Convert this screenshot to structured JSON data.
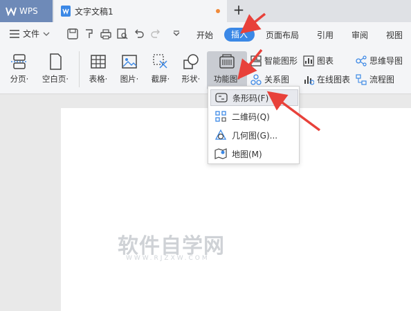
{
  "titlebar": {
    "app_tab": "WPS",
    "doc_tab": "文字文稿1"
  },
  "menubar": {
    "file_label": "文件",
    "tabs": [
      "开始",
      "插入",
      "页面布局",
      "引用",
      "审阅",
      "视图"
    ],
    "active_tab": "插入"
  },
  "ribbon": {
    "buttons": [
      {
        "label": "分页·",
        "icon": "page-break-icon"
      },
      {
        "label": "空白页·",
        "icon": "blank-page-icon"
      },
      {
        "label": "表格·",
        "icon": "table-icon"
      },
      {
        "label": "图片·",
        "icon": "picture-icon"
      },
      {
        "label": "截屏·",
        "icon": "screenshot-icon"
      },
      {
        "label": "形状·",
        "icon": "shape-icon"
      },
      {
        "label": "功能图·",
        "icon": "function-chart-icon"
      }
    ],
    "small_buttons": [
      {
        "label": "智能图形",
        "icon": "smart-art-icon"
      },
      {
        "label": "关系图",
        "icon": "relation-chart-icon"
      },
      {
        "label": "图表",
        "icon": "chart-icon"
      },
      {
        "label": "在线图表",
        "icon": "online-chart-icon"
      },
      {
        "label": "思维导图",
        "icon": "mind-map-icon"
      },
      {
        "label": "流程图",
        "icon": "flowchart-icon"
      }
    ]
  },
  "dropdown": {
    "items": [
      {
        "label": "条形码(F)",
        "icon": "barcode-icon"
      },
      {
        "label": "二维码(Q)",
        "icon": "qrcode-icon"
      },
      {
        "label": "几何图(G)...",
        "icon": "geometry-icon"
      },
      {
        "label": "地图(M)",
        "icon": "map-icon"
      }
    ]
  },
  "watermark": {
    "main": "软件自学网",
    "sub": "WWW.RJZXW.COM"
  },
  "colors": {
    "accent": "#3b88e6",
    "annotation_arrow": "#e8413a",
    "wps_tab": "#6e8ab8"
  }
}
